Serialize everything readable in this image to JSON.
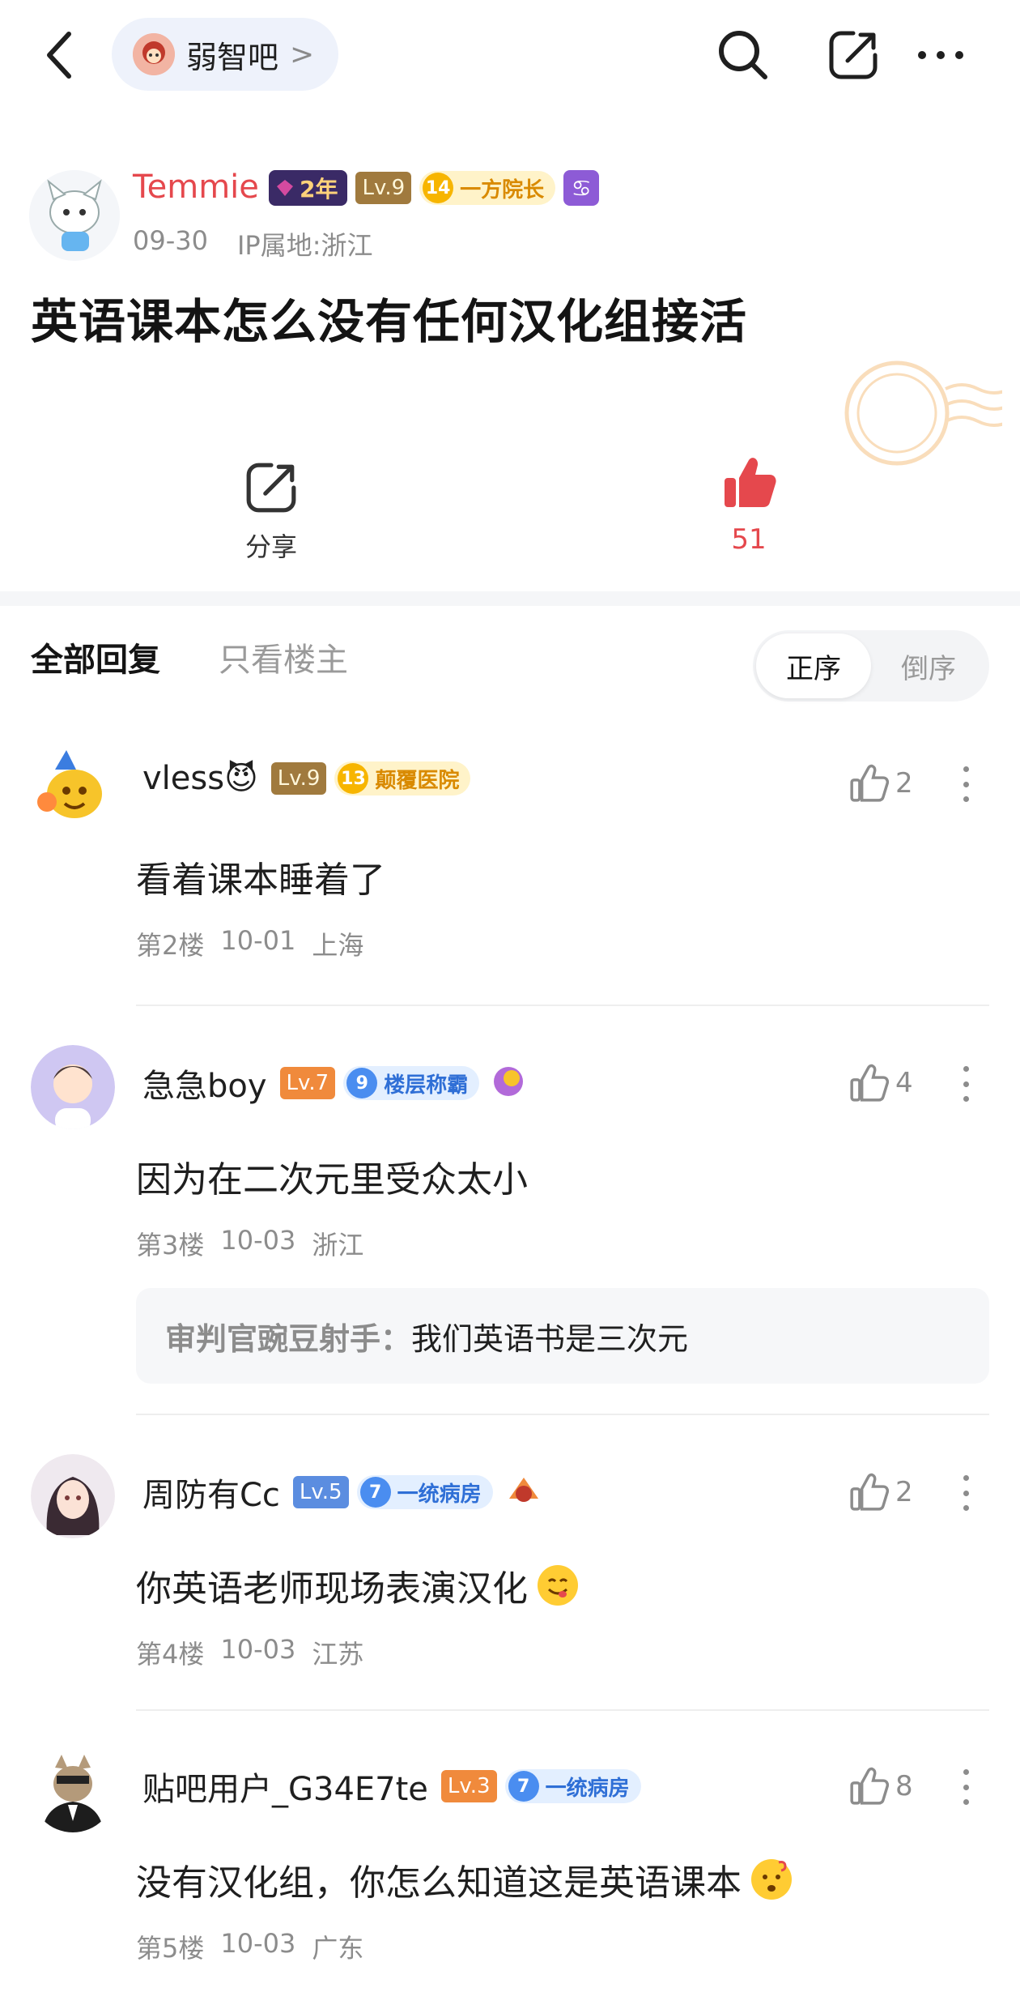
{
  "header": {
    "forum_name": "弱智吧",
    "forum_chevron": ">"
  },
  "post": {
    "author": {
      "name": "Temmie",
      "year_badge": "2年",
      "level": "Lv.9",
      "title_num": "14",
      "title": "一方院长",
      "zodiac": "♋",
      "date": "09-30",
      "ip": "IP属地:浙江"
    },
    "title": "英语课本怎么没有任何汉化组接活",
    "share_label": "分享",
    "like_count": "51"
  },
  "tabs": {
    "all": "全部回复",
    "owner_only": "只看楼主",
    "sort_asc": "正序",
    "sort_desc": "倒序"
  },
  "comments": [
    {
      "name": "vless😈",
      "level": "Lv.9",
      "badge_num": "13",
      "badge_title": "颠覆医院",
      "likes": "2",
      "text": "看着课本睡着了",
      "floor": "第2楼",
      "date": "10-01",
      "location": "上海"
    },
    {
      "name": "急急boy",
      "level": "Lv.7",
      "badge_num": "9",
      "badge_title": "楼层称霸",
      "likes": "4",
      "text": "因为在二次元里受众太小",
      "floor": "第3楼",
      "date": "10-03",
      "location": "浙江",
      "quote_author": "审判官豌豆射手：",
      "quote_text": "我们英语书是三次元"
    },
    {
      "name": "周防有Cc",
      "level": "Lv.5",
      "badge_num": "7",
      "badge_title": "一统病房",
      "likes": "2",
      "text": "你英语老师现场表演汉化",
      "floor": "第4楼",
      "date": "10-03",
      "location": "江苏"
    },
    {
      "name": "贴吧用户_G34E7te",
      "level": "Lv.3",
      "badge_num": "7",
      "badge_title": "一统病房",
      "likes": "8",
      "text": "没有汉化组，你怎么知道这是英语课本",
      "floor": "第5楼",
      "date": "10-03",
      "location": "广东"
    }
  ],
  "colors": {
    "accent_red": "#e5484d",
    "muted": "#8c8c8c"
  }
}
